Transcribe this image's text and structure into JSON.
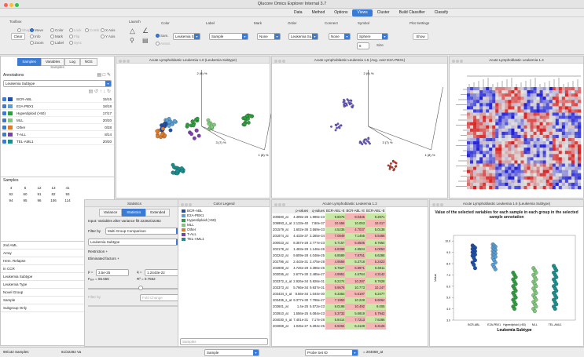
{
  "window": {
    "title": "Qlucore Omics Explorer Internal 3.7"
  },
  "menu": {
    "items": [
      "Data",
      "Method",
      "Options",
      "Views",
      "Cluster",
      "Build Classifier",
      "Classify"
    ],
    "active": "Views"
  },
  "toolbar": {
    "toolbox_label": "Toolbox",
    "launch_label": "Launch",
    "radios": {
      "shape": "Shape",
      "move": "Move",
      "info": "Info",
      "zoom": "Zoom",
      "color": "Color",
      "mark": "Mark",
      "label": "Label",
      "lock": "Lock",
      "flip": "Flip",
      "sync": "Sync",
      "comb": "Comb",
      "xaxis": "X Axis",
      "yaxis": "Y Axis"
    },
    "clear_label": "Clear",
    "color_label": "Color",
    "label_label": "Label",
    "mark_label": "Mark",
    "order_label": "Order",
    "connect_label": "Connect",
    "symbol_label": "Symbol",
    "plot_settings_label": "Plot Settings",
    "samples_opt": "Sam.",
    "annot_opt": "Annot.",
    "leukemia_sub": "Leukemia S...",
    "sample_value": "Sample",
    "mark_value": "None",
    "order_value": "Leukemia Su...",
    "connect_value": "None",
    "symbol_value": "Sphere",
    "size_value": "6",
    "size_label": "Size",
    "show_label": "Show"
  },
  "left_panel": {
    "tabs": [
      "Samples",
      "Variables",
      "Log",
      "NGS"
    ],
    "active_tab": "Samples",
    "subtitle": "Samples",
    "annotations_label": "Annotations",
    "annotation_select": "Leukemia Subtype",
    "groups": [
      {
        "name": "BCR-ABL",
        "count": "15/15",
        "color": "#1f4fa8"
      },
      {
        "name": "E2A-PBX1",
        "count": "18/18",
        "color": "#5aa0d6"
      },
      {
        "name": "Hyperdiploid (>50)",
        "count": "17/17",
        "color": "#2e9e3e"
      },
      {
        "name": "MLL",
        "count": "20/20",
        "color": "#7fc77a"
      },
      {
        "name": "Other",
        "count": "0/28",
        "color": "#e07b2a"
      },
      {
        "name": "T-ALL",
        "count": "8/14",
        "color": "#7b3fb0"
      },
      {
        "name": "TEL-AML1",
        "count": "20/20",
        "color": "#1b8f8f"
      }
    ],
    "samples_label": "Samples",
    "sample_grid": [
      [
        "4",
        "6",
        "12",
        "13",
        "41"
      ],
      [
        "92",
        "60",
        "91",
        "82",
        "93"
      ],
      [
        "94",
        "95",
        "96",
        "106",
        "114"
      ]
    ],
    "info_rows": [
      "2nd AML",
      "Array",
      "Hem. Relapse",
      "In CCR",
      "Leukemia Subtype",
      "Leukemia Type",
      "Novel Group",
      "Sample",
      "Subgroup Only"
    ]
  },
  "statistics_dialog": {
    "title": "Statistics",
    "tabs": [
      "Variance",
      "Statistics",
      "Extended"
    ],
    "active_tab": "Statistics",
    "input_text": "Input: Variables after variance filt 22282/22282",
    "filter_by_label": "Filter by",
    "filter_by_value": "Multi Group Comparison",
    "annotation_value": "Leukemia Subtype",
    "restriction_label": "Restriction",
    "eliminated_label": "Eliminated factors",
    "p_label": "p =",
    "p_value": "3.5e-25",
    "q_label": "q =",
    "q_value": "1.2443e-22",
    "fcrit_label": "Fₑₓₚ = 65.556",
    "r2_label": "R² = 0.7562",
    "filter_by2_label": "Filter by",
    "fold_change": "Fold Change"
  },
  "color_legend": {
    "title": "Color Legend",
    "items": [
      {
        "name": "BCR-ABL",
        "color": "#1f4fa8"
      },
      {
        "name": "E2A-PBX1",
        "color": "#5aa0d6"
      },
      {
        "name": "Hyperdiploid (>50)",
        "color": "#2e9e3e"
      },
      {
        "name": "MLL",
        "color": "#7fc77a"
      },
      {
        "name": "Other",
        "color": "#e07b2a"
      },
      {
        "name": "T-ALL",
        "color": "#7b3fb0"
      },
      {
        "name": "TEL-AML1",
        "color": "#1b8f8f"
      }
    ],
    "bottom_select": "Samples"
  },
  "views": {
    "v1": {
      "title": "Acute Lymphoblastic Leukemia 1.0 (Leukemia Subtype)",
      "axis1": "2 (9) %",
      "axis2": "3 (7) %",
      "axis3": "1 (8) %"
    },
    "v2": {
      "title": "Acute Lymphoblastic Leukemia 1.5 (Avg. over E2A-PBX1)",
      "axis1": "2 (9) %",
      "axis2": "3 (7) %",
      "axis3": "1 (8) %"
    },
    "v3": {
      "title": "Acute Lymphoblastic Leukemia 1.4"
    },
    "v4": {
      "title": "Acute Lymphoblastic Leukemia 1.2"
    },
    "v5": {
      "title": "Acute Lymphoblastic Leukemia 1.6 (Leukemia Subtype)"
    }
  },
  "table": {
    "headers": [
      "",
      "p-values",
      "q-values",
      "BCR-ABL:-E",
      "BCR-ABL:-E",
      "BCR-ABL:-E"
    ],
    "rows": [
      [
        "200600_at",
        "4.399e-28",
        "1.998e-23",
        "9.6075",
        "9.0345",
        "9.2971"
      ],
      [
        "209993_s_at",
        "2.133e-40",
        "7.80e-37",
        "10.556",
        "10.053",
        "10.017"
      ],
      [
        "201579_at",
        "1.602e-36",
        "3.569e-33",
        "4.5236",
        "4.7037",
        "5.0138"
      ],
      [
        "201874_at",
        "4.433e-37",
        "2.265e-34",
        "7.0849",
        "7.1455",
        "6.5466"
      ],
      [
        "200023_at",
        "8.357e-28",
        "2.777e-23",
        "5.7157",
        "5.6505",
        "8.7664"
      ],
      [
        "202178_at",
        "1.463e-29",
        "1.146e-26",
        "6.8398",
        "4.8504",
        "5.0053"
      ],
      [
        "202242_at",
        "9.809e-28",
        "4.048e-25",
        "6.8589",
        "7.8751",
        "6.6286"
      ],
      [
        "202796_at",
        "2.443e-31",
        "2.475e-28",
        "4.9556",
        "5.3718",
        "5.2423"
      ],
      [
        "202808_at",
        "4.725e-29",
        "3.396e-26",
        "5.7827",
        "6.8971",
        "6.6011"
      ],
      [
        "203036_at",
        "2.677e-30",
        "2.485e-27",
        "4.9951",
        "4.6764",
        "4.3142"
      ],
      [
        "203372_s_at",
        "2.926e-34",
        "5.926e-31",
        "9.2274",
        "10.287",
        "9.7628"
      ],
      [
        "203373_at",
        "5.766e-34",
        "9.937e-31",
        "9.9676",
        "10.773",
        "10.247"
      ],
      [
        "203434_s_at",
        "8.56e-34",
        "1.044e-30",
        "6.3363",
        "5.6197",
        "6.2477"
      ],
      [
        "203435_s_at",
        "9.377e-30",
        "7.798e-27",
        "7.1953",
        "10.228",
        "8.6064"
      ],
      [
        "203601_at",
        "1.4e-25",
        "5.572e-23",
        "8.0198",
        "10.492",
        "9.005"
      ],
      [
        "203910_at",
        "1.556e-25",
        "6.084e-23",
        "5.3732",
        "5.6919",
        "5.7942"
      ],
      [
        "204030_s_at",
        "7.401e-31",
        "7.17e-28",
        "5.8414",
        "7.7213",
        "7.6286"
      ],
      [
        "204069_at",
        "1.045e-27",
        "6.294e-25",
        "5.9264",
        "6.4128",
        "6.3126"
      ]
    ],
    "bottom_select": "Sample",
    "probe_label": "Probe Set ID",
    "probe_value": "= 204069_at"
  },
  "chart_data": {
    "type": "scatter",
    "title": "Value of the selected variables for each sample in each group in the selected sample annotation",
    "xlabel": "Leukemia Subtype",
    "ylabel": "Value",
    "categories": [
      "BCR-ABL",
      "E2A-PBX1",
      "Hyperdiploid (>50)",
      "MLL",
      "TEL-AML1"
    ],
    "colors": [
      "#1f4fa8",
      "#5aa0d6",
      "#2e9e3e",
      "#7fc77a",
      "#1b8f8f"
    ],
    "yticks": [
      "10.0",
      "9.0",
      "8.0",
      "7.0",
      "6.0",
      "5.0",
      "4.0",
      "3.0"
    ],
    "ylim": [
      3,
      10.5
    ],
    "series": [
      {
        "values": [
          9.6,
          9.5,
          9.4,
          9.3,
          9.2,
          9.1,
          9.0,
          8.9,
          8.8,
          8.7,
          8.5,
          8.3,
          8.1,
          7.9,
          7.6
        ]
      },
      {
        "values": [
          9.7,
          9.6,
          9.5,
          9.4,
          9.3,
          9.2,
          9.1,
          9.0,
          8.9,
          8.8,
          8.7,
          8.6,
          8.5,
          8.3,
          8.1,
          7.9,
          7.7,
          7.5
        ]
      },
      {
        "values": [
          7.2,
          7.0,
          6.8,
          6.6,
          6.4,
          6.2,
          6.0,
          5.8,
          5.6,
          5.4,
          5.2,
          5.0,
          4.8,
          4.6,
          4.4,
          4.2,
          4.0
        ]
      },
      {
        "values": [
          7.6,
          7.4,
          7.2,
          7.0,
          6.8,
          6.6,
          6.4,
          6.2,
          6.0,
          5.8,
          5.6,
          5.4,
          5.2,
          5.0,
          4.8,
          4.6,
          4.4,
          4.2,
          4.0,
          3.8
        ]
      },
      {
        "values": [
          7.8,
          7.6,
          7.4,
          7.2,
          7.0,
          6.8,
          6.6,
          6.4,
          6.2,
          6.0,
          5.8,
          5.6,
          5.4,
          5.2,
          5.0,
          4.8,
          4.6,
          4.4,
          4.2,
          4.0
        ]
      }
    ]
  },
  "status": {
    "left": "90/132 Samples",
    "vars": "61/22282 Va"
  }
}
